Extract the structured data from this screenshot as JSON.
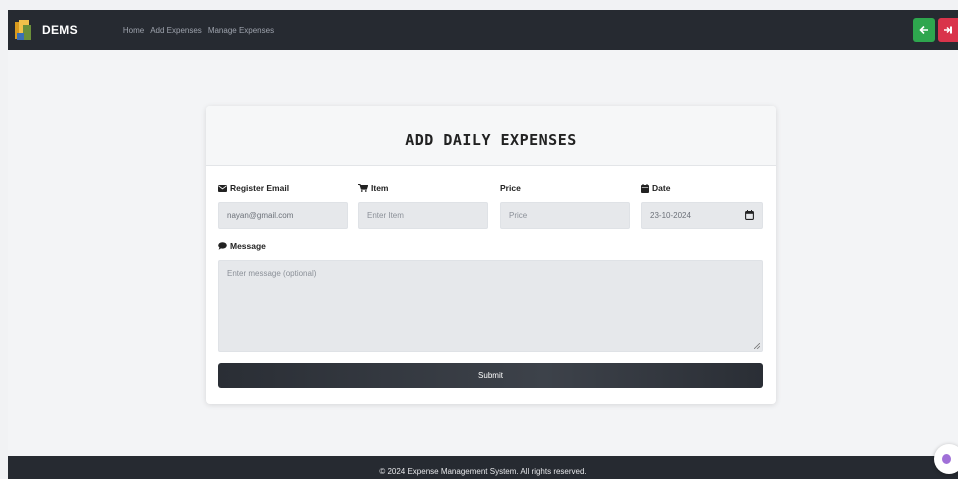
{
  "navbar": {
    "brand": "DEMS",
    "links": [
      "Home",
      "Add Expenses",
      "Manage Expenses"
    ],
    "back_icon": "arrow-left-icon",
    "logout_icon": "logout-icon",
    "colors": {
      "bg": "#262a31",
      "green": "#2ea64e",
      "red": "#d9344b"
    }
  },
  "form": {
    "title": "ADD DAILY EXPENSES",
    "email": {
      "label": "Register Email",
      "icon": "envelope-icon",
      "value": "nayan@gmail.com"
    },
    "item": {
      "label": "Item",
      "icon": "cart-icon",
      "placeholder": "Enter Item"
    },
    "price": {
      "label": "Price",
      "placeholder": "Price"
    },
    "date": {
      "label": "Date",
      "icon": "calendar-icon",
      "value": "23-10-2024"
    },
    "message": {
      "label": "Message",
      "icon": "comment-icon",
      "placeholder": "Enter message (optional)"
    },
    "submit_label": "Submit"
  },
  "footer": {
    "text": "© 2024 Expense Management System. All rights reserved."
  }
}
